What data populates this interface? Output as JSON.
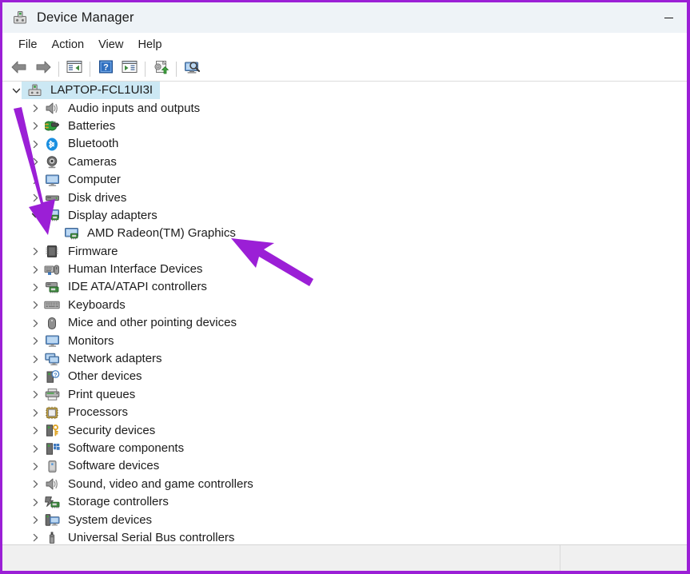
{
  "window": {
    "title": "Device Manager",
    "app_icon": "device-manager-icon",
    "minimize_label": "—",
    "border_color": "#9b1fd6",
    "titlebar_bg": "#eef3f7"
  },
  "menubar": {
    "items": [
      {
        "label": "File",
        "name": "menu-file"
      },
      {
        "label": "Action",
        "name": "menu-action"
      },
      {
        "label": "View",
        "name": "menu-view"
      },
      {
        "label": "Help",
        "name": "menu-help"
      }
    ]
  },
  "toolbar": {
    "buttons": [
      {
        "name": "back-button",
        "icon": "back-arrow-icon",
        "tooltip": "Back"
      },
      {
        "name": "forward-button",
        "icon": "forward-arrow-icon",
        "tooltip": "Forward"
      },
      {
        "name": "show-hide-console-tree-button",
        "icon": "console-tree-icon",
        "tooltip": "Show/Hide Console Tree"
      },
      {
        "name": "help-button",
        "icon": "help-question-icon",
        "tooltip": "Help"
      },
      {
        "name": "properties-button",
        "icon": "properties-icon",
        "tooltip": "Properties"
      },
      {
        "name": "update-driver-button",
        "icon": "update-driver-icon",
        "tooltip": "Update driver"
      },
      {
        "name": "scan-hardware-changes-button",
        "icon": "scan-hardware-icon",
        "tooltip": "Scan for hardware changes"
      }
    ]
  },
  "tree": {
    "selected": "LAPTOP-FCL1UI3I",
    "selection_color": "#cce8f4",
    "nodes": [
      {
        "label": "LAPTOP-FCL1UI3I",
        "level": 0,
        "expanded": true,
        "icon": "computer-root-icon",
        "selected": true
      },
      {
        "label": "Audio inputs and outputs",
        "level": 1,
        "expanded": false,
        "icon": "speaker-icon"
      },
      {
        "label": "Batteries",
        "level": 1,
        "expanded": false,
        "icon": "battery-icon"
      },
      {
        "label": "Bluetooth",
        "level": 1,
        "expanded": false,
        "icon": "bluetooth-icon"
      },
      {
        "label": "Cameras",
        "level": 1,
        "expanded": false,
        "icon": "camera-icon"
      },
      {
        "label": "Computer",
        "level": 1,
        "expanded": false,
        "icon": "monitor-icon"
      },
      {
        "label": "Disk drives",
        "level": 1,
        "expanded": false,
        "icon": "disk-drive-icon"
      },
      {
        "label": "Display adapters",
        "level": 1,
        "expanded": true,
        "icon": "display-adapter-icon"
      },
      {
        "label": "AMD Radeon(TM) Graphics",
        "level": 2,
        "expanded": null,
        "icon": "display-adapter-icon"
      },
      {
        "label": "Firmware",
        "level": 1,
        "expanded": false,
        "icon": "firmware-chip-icon"
      },
      {
        "label": "Human Interface Devices",
        "level": 1,
        "expanded": false,
        "icon": "hid-icon"
      },
      {
        "label": "IDE ATA/ATAPI controllers",
        "level": 1,
        "expanded": false,
        "icon": "ide-controller-icon"
      },
      {
        "label": "Keyboards",
        "level": 1,
        "expanded": false,
        "icon": "keyboard-icon"
      },
      {
        "label": "Mice and other pointing devices",
        "level": 1,
        "expanded": false,
        "icon": "mouse-icon"
      },
      {
        "label": "Monitors",
        "level": 1,
        "expanded": false,
        "icon": "monitor-icon"
      },
      {
        "label": "Network adapters",
        "level": 1,
        "expanded": false,
        "icon": "network-adapter-icon"
      },
      {
        "label": "Other devices",
        "level": 1,
        "expanded": false,
        "icon": "other-device-icon"
      },
      {
        "label": "Print queues",
        "level": 1,
        "expanded": false,
        "icon": "printer-icon"
      },
      {
        "label": "Processors",
        "level": 1,
        "expanded": false,
        "icon": "processor-icon"
      },
      {
        "label": "Security devices",
        "level": 1,
        "expanded": false,
        "icon": "security-device-icon"
      },
      {
        "label": "Software components",
        "level": 1,
        "expanded": false,
        "icon": "software-component-icon"
      },
      {
        "label": "Software devices",
        "level": 1,
        "expanded": false,
        "icon": "software-device-icon"
      },
      {
        "label": "Sound, video and game controllers",
        "level": 1,
        "expanded": false,
        "icon": "speaker-icon"
      },
      {
        "label": "Storage controllers",
        "level": 1,
        "expanded": false,
        "icon": "storage-controller-icon"
      },
      {
        "label": "System devices",
        "level": 1,
        "expanded": false,
        "icon": "system-device-icon"
      },
      {
        "label": "Universal Serial Bus controllers",
        "level": 1,
        "expanded": false,
        "icon": "usb-controller-icon"
      }
    ]
  },
  "statusbar": {
    "left_text": "",
    "right_text": ""
  },
  "annotations": {
    "color": "#9b1fd6",
    "arrows": [
      {
        "name": "annotation-arrow-display-adapters",
        "points_to": "Display adapters"
      },
      {
        "name": "annotation-arrow-amd-radeon-graphics",
        "points_to": "AMD Radeon(TM) Graphics"
      }
    ]
  }
}
